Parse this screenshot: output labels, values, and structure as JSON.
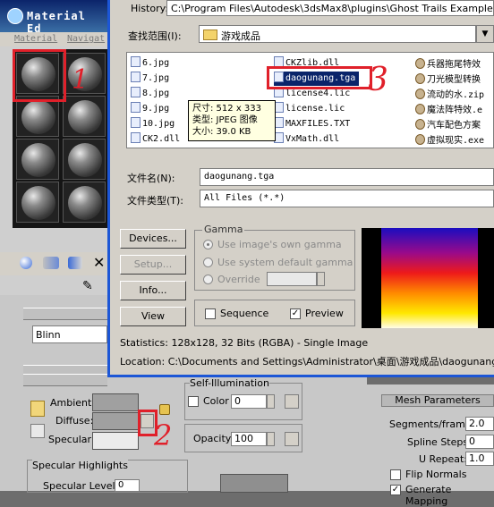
{
  "material_editor": {
    "title": "Material Ed",
    "menu": [
      "Material",
      "Navigat"
    ],
    "shader": "Blinn",
    "labels": {
      "ambient": "Ambient:",
      "diffuse": "Diffuse:",
      "specular": "Specular:",
      "specular_highlights": "Specular Highlights",
      "specular_level": "Specular Level:",
      "specular_level_value": "0",
      "self_illumination": "Self-Illumination",
      "color": "Color",
      "color_value": "0",
      "opacity": "Opacity:",
      "opacity_value": "100"
    }
  },
  "annotations": {
    "one": "1",
    "two": "2",
    "three": "3"
  },
  "dialog": {
    "history_label": "History:",
    "history_path": "C:\\Program Files\\Autodesk\\3dsMax8\\plugins\\Ghost Trails Examples & Images",
    "lookin_label": "查找范围(I):",
    "lookin_value": "游戏成品",
    "files": {
      "col1": [
        "6.jpg",
        "7.jpg",
        "8.jpg",
        "9.jpg",
        "10.jpg",
        "CK2.dll"
      ],
      "col2": [
        "CKZlib.dll",
        "daogunang.tga",
        "license4.lic",
        "license.lic",
        "MAXFILES.TXT",
        "VxMath.dll"
      ],
      "col3": [
        "兵器拖尾特效",
        "刀光模型转换",
        "流动的水.zip",
        "魔法阵特效.e",
        "汽车配色方案",
        "虚拟现实.exe"
      ]
    },
    "tooltip": {
      "size": "尺寸: 512 x 333",
      "type": "类型: JPEG 图像",
      "filesize": "大小: 39.0 KB"
    },
    "filename_label": "文件名(N):",
    "filename_value": "daogunang.tga",
    "filetype_label": "文件类型(T):",
    "filetype_value": "All Files (*.*)",
    "buttons": {
      "devices": "Devices...",
      "setup": "Setup...",
      "info": "Info...",
      "view": "View"
    },
    "gamma": {
      "title": "Gamma",
      "opt1": "Use image's own gamma",
      "opt2": "Use system default gamma",
      "opt3": "Override",
      "override_value": ""
    },
    "sequence": "Sequence",
    "preview": "Preview",
    "statistics": "Statistics:  128x128, 32 Bits (RGBA) - Single Image",
    "location": "Location:  C:\\Documents and Settings\\Administrator\\桌面\\游戏成品\\daogunang.tga"
  },
  "particle_panel": {
    "header": "Mesh Parameters",
    "segments_label": "Segments/frame:",
    "segments_value": "2.0",
    "spline_label": "Spline Steps:",
    "spline_value": "0",
    "urepeat_label": "U Repeat:",
    "urepeat_value": "1.0",
    "flip_normals": "Flip Normals",
    "generate_mapping": "Generate Mapping"
  }
}
